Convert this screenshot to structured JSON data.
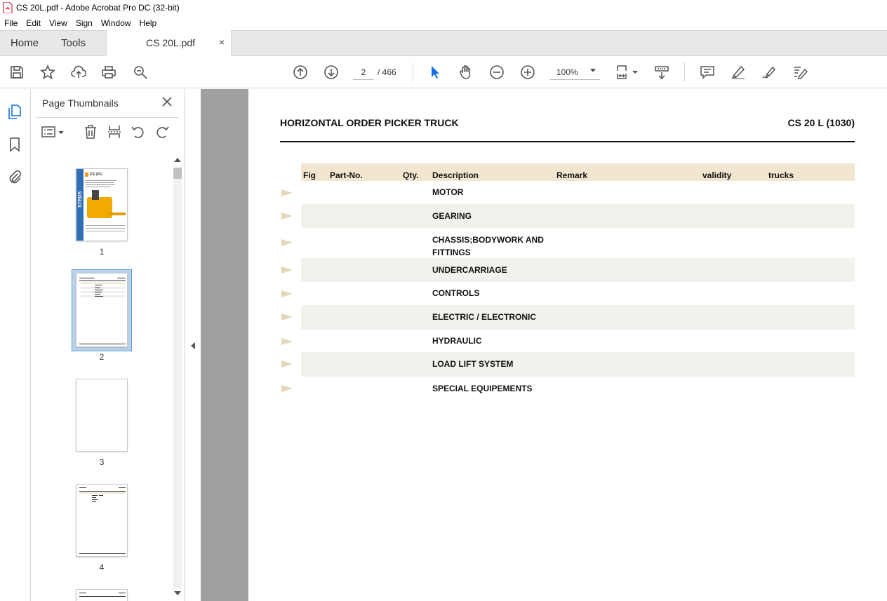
{
  "window": {
    "title": "CS 20L.pdf - Adobe Acrobat Pro DC (32-bit)"
  },
  "menu": [
    "File",
    "Edit",
    "View",
    "Sign",
    "Window",
    "Help"
  ],
  "tabs": {
    "home": "Home",
    "tools": "Tools",
    "document": "CS 20L.pdf",
    "close_glyph": "×"
  },
  "toolbar": {
    "current_page": "2",
    "page_total": "/ 466",
    "zoom": "100%",
    "icons": [
      "save-icon",
      "star-icon",
      "upload-icon",
      "print-icon",
      "search-icon",
      "page-up-icon",
      "page-down-icon",
      "select-cursor-icon",
      "hand-icon",
      "zoom-out-icon",
      "zoom-in-icon",
      "fit-page-icon",
      "scroll-mode-icon",
      "comment-icon",
      "highlight-icon",
      "sign-icon",
      "edit-icon"
    ]
  },
  "colors": {
    "accent": "#1473e6",
    "table_header": "#f2e6d0",
    "row_alt": "#f3f1ec",
    "doc_background": "#a0a0a0"
  },
  "thumbnails": {
    "panel_title": "Page Thumbnails",
    "pages": [
      "1",
      "2",
      "3",
      "4"
    ],
    "selected": "2",
    "cover_model": "CS 20 L",
    "cover_brand": "STEDS"
  },
  "document": {
    "title": "HORIZONTAL ORDER PICKER TRUCK",
    "code": "CS 20 L (1030)",
    "headers": {
      "fig": "Fig",
      "part_no": "Part-No.",
      "qty": "Qty.",
      "description": "Description",
      "remark": "Remark",
      "validity": "validity",
      "trucks": "trucks"
    },
    "rows": [
      {
        "description": "MOTOR"
      },
      {
        "description": "GEARING"
      },
      {
        "description": "CHASSIS;BODYWORK AND",
        "description2": "FITTINGS"
      },
      {
        "description": "UNDERCARRIAGE"
      },
      {
        "description": "CONTROLS"
      },
      {
        "description": "ELECTRIC / ELECTRONIC"
      },
      {
        "description": "HYDRAULIC"
      },
      {
        "description": "LOAD LIFT SYSTEM"
      },
      {
        "description": "SPECIAL EQUIPEMENTS"
      }
    ]
  }
}
